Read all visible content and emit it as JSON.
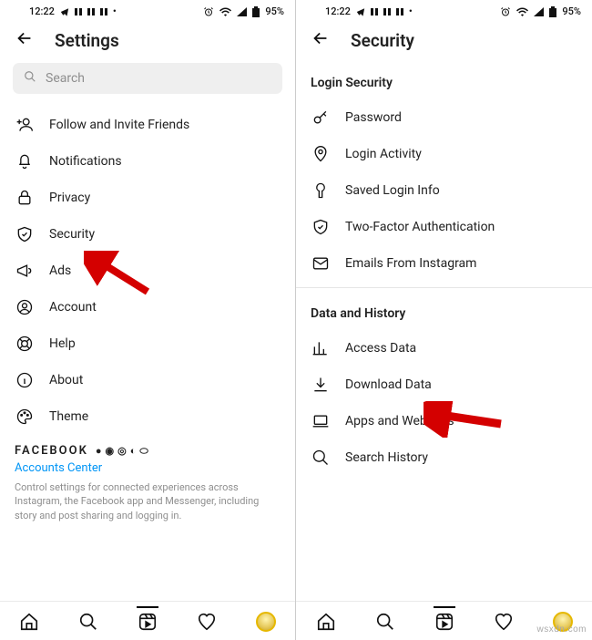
{
  "status": {
    "time": "12:22",
    "battery": "95%"
  },
  "left": {
    "title": "Settings",
    "search_placeholder": "Search",
    "items": [
      {
        "label": "Follow and Invite Friends",
        "icon": "add-friend-icon"
      },
      {
        "label": "Notifications",
        "icon": "bell-icon"
      },
      {
        "label": "Privacy",
        "icon": "lock-icon"
      },
      {
        "label": "Security",
        "icon": "shield-icon"
      },
      {
        "label": "Ads",
        "icon": "megaphone-icon"
      },
      {
        "label": "Account",
        "icon": "user-circle-icon"
      },
      {
        "label": "Help",
        "icon": "help-icon"
      },
      {
        "label": "About",
        "icon": "info-icon"
      },
      {
        "label": "Theme",
        "icon": "palette-icon"
      }
    ],
    "brand": "FACEBOOK",
    "accounts_center": "Accounts Center",
    "accounts_desc": "Control settings for connected experiences across Instagram, the Facebook app and Messenger, including story and post sharing and logging in."
  },
  "right": {
    "title": "Security",
    "section1": "Login Security",
    "items1": [
      {
        "label": "Password",
        "icon": "key-icon"
      },
      {
        "label": "Login Activity",
        "icon": "location-icon"
      },
      {
        "label": "Saved Login Info",
        "icon": "keyhole-icon"
      },
      {
        "label": "Two-Factor Authentication",
        "icon": "shield-check-icon"
      },
      {
        "label": "Emails From Instagram",
        "icon": "mail-icon"
      }
    ],
    "section2": "Data and History",
    "items2": [
      {
        "label": "Access Data",
        "icon": "bar-chart-icon"
      },
      {
        "label": "Download Data",
        "icon": "download-icon"
      },
      {
        "label": "Apps and Websites",
        "icon": "laptop-icon"
      },
      {
        "label": "Search History",
        "icon": "search-icon"
      }
    ]
  },
  "watermark": "wsxdn.com"
}
